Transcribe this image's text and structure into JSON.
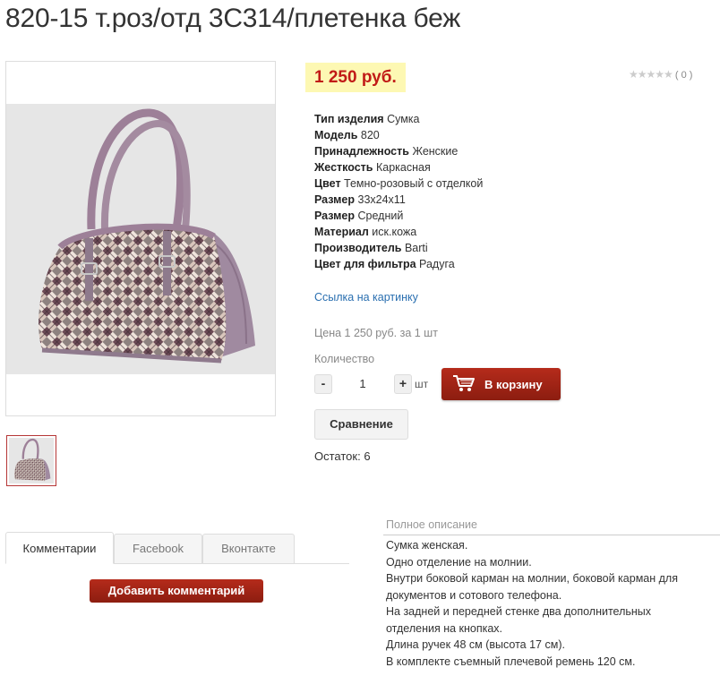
{
  "product": {
    "title": "820-15 т.роз/отд 3С314/плетенка беж",
    "price": "1 250 руб.",
    "rating_stars": "★★★★★",
    "rating_count": "( 0 )",
    "specs": [
      {
        "label": "Тип изделия",
        "value": "Сумка"
      },
      {
        "label": "Модель",
        "value": "820"
      },
      {
        "label": "Принадлежность",
        "value": "Женские"
      },
      {
        "label": "Жесткость",
        "value": "Каркасная"
      },
      {
        "label": "Цвет",
        "value": "Темно-розовый с отделкой"
      },
      {
        "label": "Размер",
        "value": "33x24x11"
      },
      {
        "label": "Размер",
        "value": "Средний"
      },
      {
        "label": "Материал",
        "value": "иск.кожа"
      },
      {
        "label": "Производитель",
        "value": "Barti"
      },
      {
        "label": "Цвет для фильтра",
        "value": "Радуга"
      }
    ],
    "picture_link": "Ссылка на картинку",
    "price_per_unit": "Цена 1 250 руб. за 1 шт",
    "quantity_label": "Количество",
    "quantity_value": "1",
    "quantity_unit": "шт",
    "minus_label": "-",
    "plus_label": "+",
    "cart_button": "В корзину",
    "compare_button": "Сравнение",
    "stock": "Остаток: 6"
  },
  "tabs": [
    {
      "label": "Комментарии"
    },
    {
      "label": "Facebook"
    },
    {
      "label": "Вконтакте"
    }
  ],
  "add_comment_button": "Добавить комментарий",
  "description": {
    "heading": "Полное описание",
    "lines": [
      "Сумка женская.",
      "Одно отделение на молнии.",
      "Внутри боковой карман на молнии, боковой карман для",
      "документов и сотового телефона.",
      "На задней и передней стенке два дополнительных",
      "отделения на кнопках.",
      "Длина ручек 48 см (высота 17 см).",
      "В комплекте съемный плечевой ремень 120 см."
    ]
  },
  "colors": {
    "accent_red": "#a52414",
    "price_bg": "#fdf8b3",
    "price_text": "#c11b17",
    "link_blue": "#2a6fb0",
    "bag_purple": "#a48ba0"
  },
  "icons": {
    "cart": "shopping-cart-icon",
    "star": "star-icon"
  }
}
